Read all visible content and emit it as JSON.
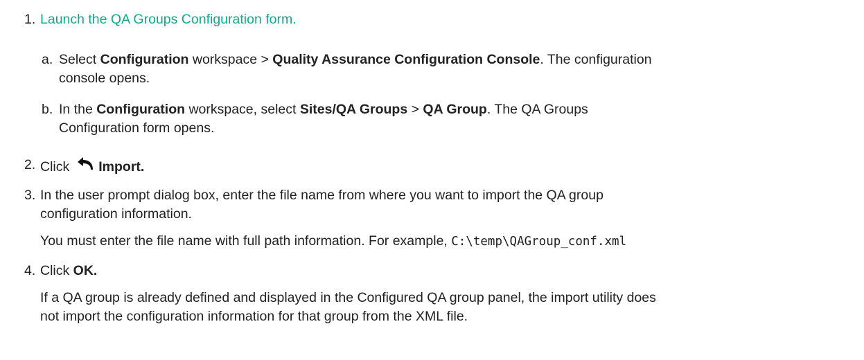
{
  "step1": {
    "number": "1.",
    "link_text": "Launch the QA Groups Configuration form.",
    "a": {
      "letter": "a.",
      "t1": "Select ",
      "b1": "Configuration",
      "t2": " workspace > ",
      "b2": "Quality Assurance Configuration Console",
      "t3": ". The configuration",
      "t4": "console opens."
    },
    "b": {
      "letter": "b.",
      "t1": "In the ",
      "b1": "Configuration",
      "t2": " workspace, select ",
      "b2": "Sites/QA Groups",
      "t3": " > ",
      "b3": "QA Group",
      "t4": ". The QA Groups",
      "t5": "Configuration form opens."
    }
  },
  "step2": {
    "number": "2.",
    "t1": "Click",
    "icon": "undo-arrow-icon",
    "b1": "Import."
  },
  "step3": {
    "number": "3.",
    "line1": "In the user prompt dialog box, enter the file name from where you want to import the QA group",
    "line2": "configuration information.",
    "note": "You must enter the file name with full path information. For example,",
    "code": "C:\\temp\\QAGroup_conf.xml"
  },
  "step4": {
    "number": "4.",
    "t1": "Click ",
    "b1": "OK.",
    "note1": "If a QA group is already defined and displayed in the Configured QA group panel, the import utility does",
    "note2": "not import the configuration information for that group from the XML file."
  }
}
